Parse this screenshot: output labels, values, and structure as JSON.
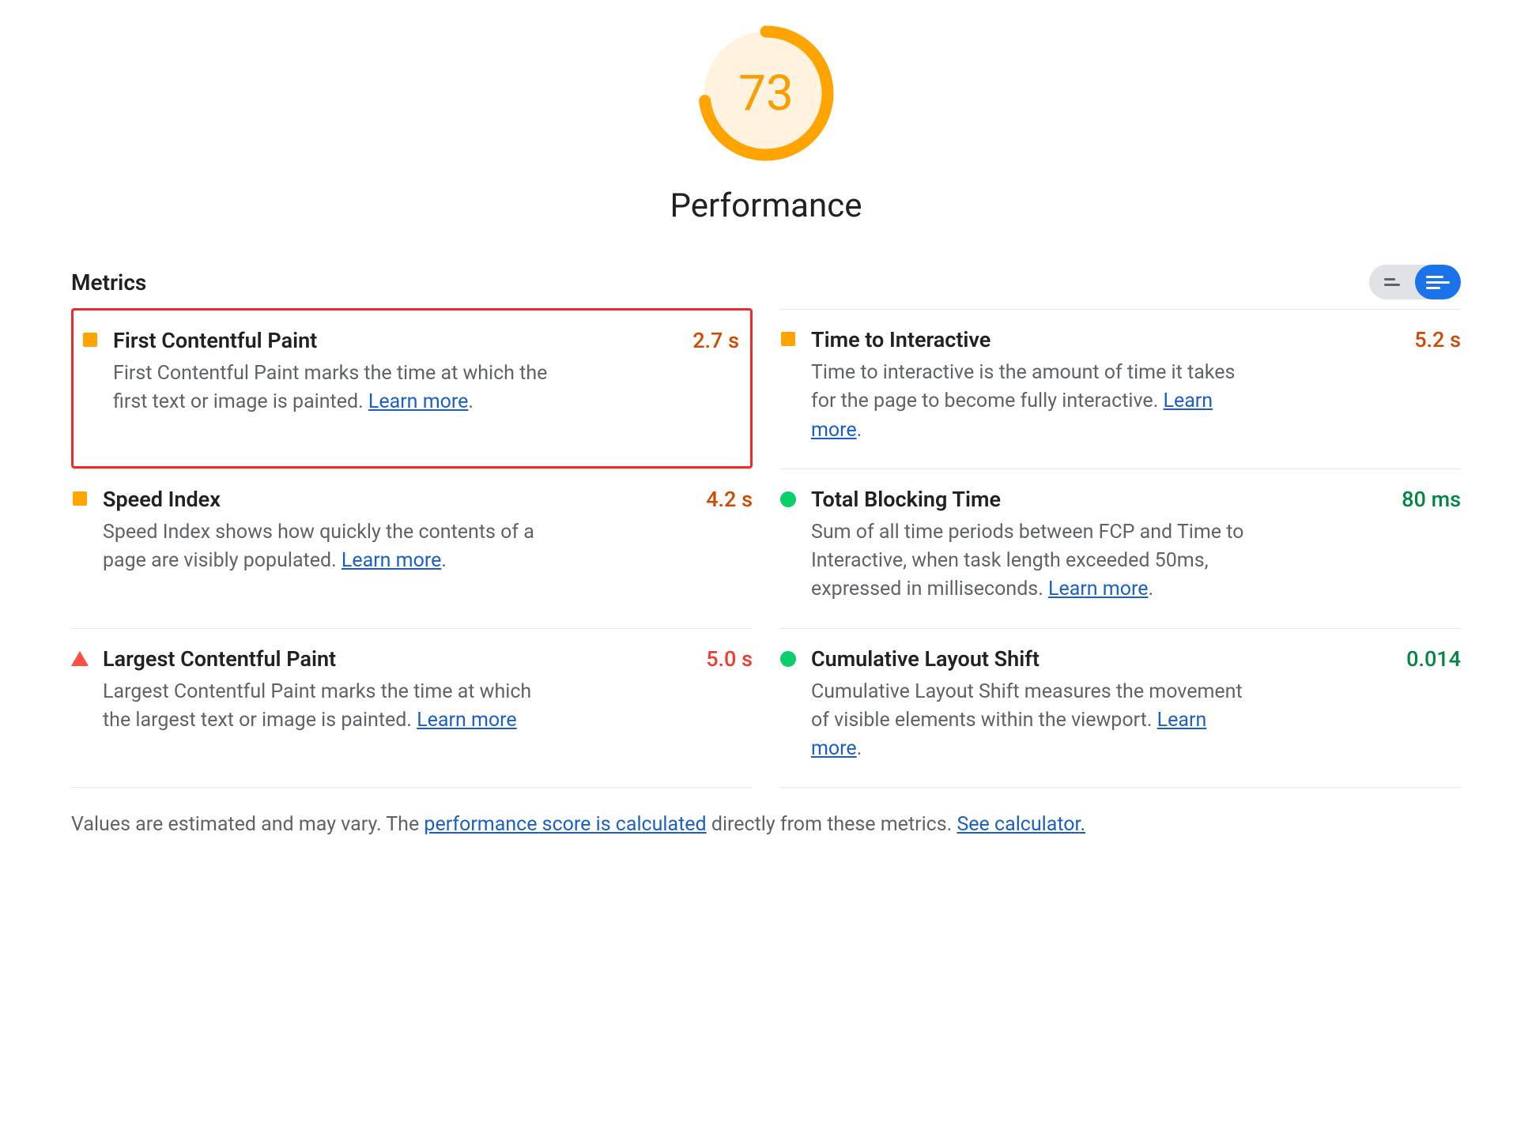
{
  "gauge": {
    "score": "73",
    "title": "Performance",
    "percent": 73,
    "color": "#ffa400",
    "track": "#fff3e0"
  },
  "metrics_header": "Metrics",
  "metrics": [
    {
      "title": "First Contentful Paint",
      "value": "2.7 s",
      "status": "average",
      "desc_pre": "First Contentful Paint marks the time at which the first text or image is painted. ",
      "learn": "Learn more",
      "desc_post": ".",
      "highlight": true
    },
    {
      "title": "Time to Interactive",
      "value": "5.2 s",
      "status": "average",
      "desc_pre": "Time to interactive is the amount of time it takes for the page to become fully interactive. ",
      "learn": "Learn more",
      "desc_post": "."
    },
    {
      "title": "Speed Index",
      "value": "4.2 s",
      "status": "average",
      "desc_pre": "Speed Index shows how quickly the contents of a page are visibly populated. ",
      "learn": "Learn more",
      "desc_post": "."
    },
    {
      "title": "Total Blocking Time",
      "value": "80 ms",
      "status": "good",
      "desc_pre": "Sum of all time periods between FCP and Time to Interactive, when task length exceeded 50ms, expressed in milliseconds. ",
      "learn": "Learn more",
      "desc_post": "."
    },
    {
      "title": "Largest Contentful Paint",
      "value": "5.0 s",
      "status": "poor",
      "desc_pre": "Largest Contentful Paint marks the time at which the largest text or image is painted. ",
      "learn": "Learn more",
      "desc_post": ""
    },
    {
      "title": "Cumulative Layout Shift",
      "value": "0.014",
      "status": "good",
      "desc_pre": "Cumulative Layout Shift measures the movement of visible elements within the viewport. ",
      "learn": "Learn more",
      "desc_post": "."
    }
  ],
  "footnote": {
    "pre": "Values are estimated and may vary. The ",
    "link1": "performance score is calculated",
    "mid": " directly from these metrics. ",
    "link2": "See calculator."
  }
}
